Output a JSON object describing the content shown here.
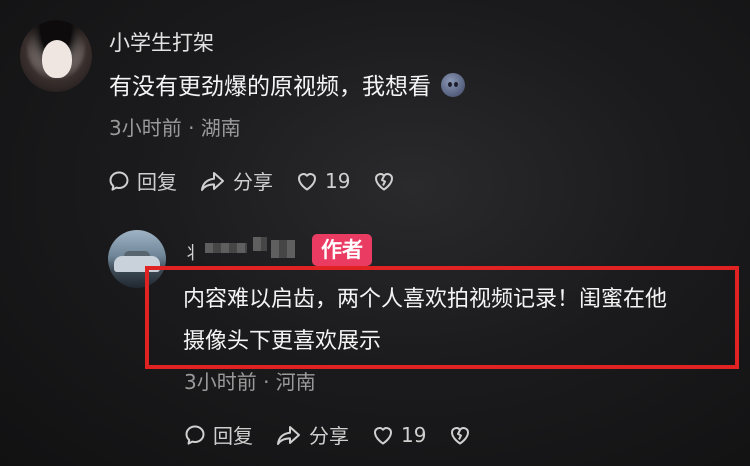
{
  "comment": {
    "username": "小学生打架",
    "text": "有没有更劲爆的原视频，我想看",
    "emoji_icon": "smile-emoji-icon",
    "meta": "3小时前 · 湖南",
    "actions": {
      "reply_label": "回复",
      "share_label": "分享",
      "like_count": "19"
    }
  },
  "reply": {
    "username_visible_glyph": "丬",
    "author_badge": "作者",
    "text_line_1": "内容难以启齿，两个人喜欢拍视频记录！闺蜜在他",
    "text_line_2": "摄像头下更喜欢展示",
    "meta": "3小时前 · 河南",
    "actions": {
      "reply_label": "回复",
      "share_label": "分享",
      "like_count": "19"
    }
  },
  "colors": {
    "author_badge": "#ea3c63",
    "highlight_border": "#e02222",
    "meta_text": "#9a9a9a"
  }
}
